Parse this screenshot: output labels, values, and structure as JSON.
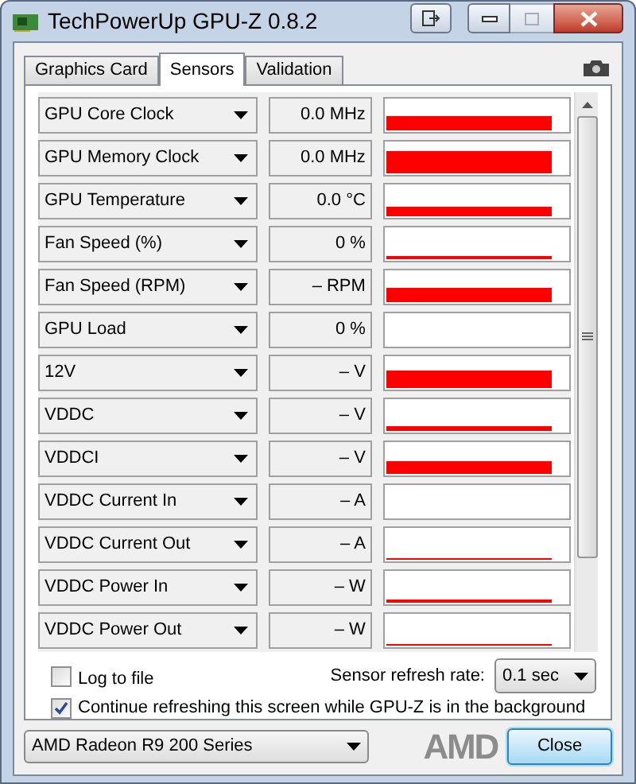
{
  "window": {
    "title": "TechPowerUp GPU-Z 0.8.2"
  },
  "tabs": [
    {
      "label": "Graphics Card",
      "selected": false
    },
    {
      "label": "Sensors",
      "selected": true
    },
    {
      "label": "Validation",
      "selected": false
    }
  ],
  "sensors": [
    {
      "name": "GPU Core Clock",
      "reading": "0.0 MHz"
    },
    {
      "name": "GPU Memory Clock",
      "reading": "0.0 MHz"
    },
    {
      "name": "GPU Temperature",
      "reading": "0.0 °C"
    },
    {
      "name": "Fan Speed (%)",
      "reading": "0 %"
    },
    {
      "name": "Fan Speed (RPM)",
      "reading": "– RPM"
    },
    {
      "name": "GPU Load",
      "reading": "0 %"
    },
    {
      "name": "12V",
      "reading": "– V"
    },
    {
      "name": "VDDC",
      "reading": "– V"
    },
    {
      "name": "VDDCI",
      "reading": "– V"
    },
    {
      "name": "VDDC Current In",
      "reading": "– A"
    },
    {
      "name": "VDDC Current Out",
      "reading": "– A"
    },
    {
      "name": "VDDC Power In",
      "reading": "– W"
    },
    {
      "name": "VDDC Power Out",
      "reading": "– W"
    }
  ],
  "log_to_file": {
    "label": "Log to file",
    "checked": false
  },
  "refresh_rate": {
    "label": "Sensor refresh rate:",
    "value": "0.1 sec"
  },
  "background_refresh": {
    "label": "Continue refreshing this screen while GPU-Z is in the background",
    "checked": true
  },
  "gpu_select": {
    "value": "AMD Radeon R9 200 Series"
  },
  "logo": "AMD",
  "close_button": "Close"
}
